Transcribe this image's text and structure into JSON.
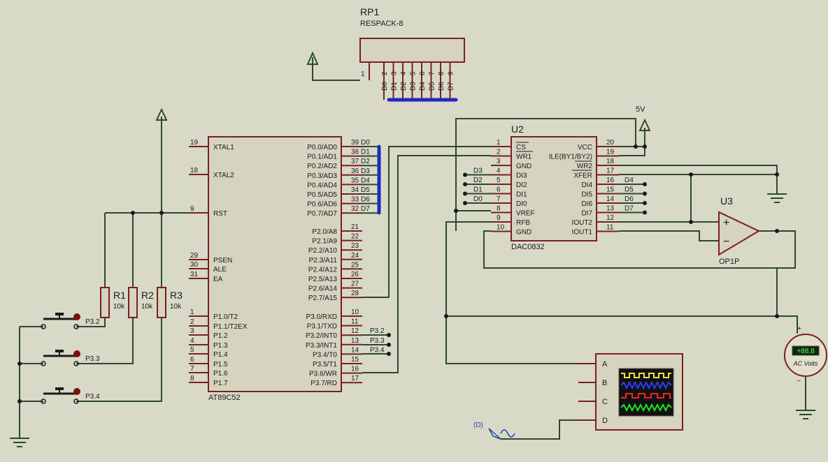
{
  "rp1": {
    "ref": "RP1",
    "value": "RESPACK-8",
    "pin1": "1",
    "pins": [
      "2",
      "3",
      "4",
      "5",
      "6",
      "7",
      "8",
      "9"
    ],
    "labels": [
      "D0",
      "D1",
      "D2",
      "D3",
      "D4",
      "D5",
      "D6",
      "D7"
    ]
  },
  "mcu": {
    "part": "AT89C52",
    "left": [
      {
        "num": "19",
        "name": "XTAL1"
      },
      {
        "num": "18",
        "name": "XTAL2"
      },
      {
        "num": "9",
        "name": "RST"
      },
      {
        "num": "29",
        "name": "PSEN"
      },
      {
        "num": "30",
        "name": "ALE"
      },
      {
        "num": "31",
        "name": "EA"
      },
      {
        "num": "1",
        "name": "P1.0/T2"
      },
      {
        "num": "2",
        "name": "P1.1/T2EX"
      },
      {
        "num": "3",
        "name": "P1.2"
      },
      {
        "num": "4",
        "name": "P1.3"
      },
      {
        "num": "5",
        "name": "P1.4"
      },
      {
        "num": "6",
        "name": "P1.5"
      },
      {
        "num": "7",
        "name": "P1.6"
      },
      {
        "num": "8",
        "name": "P1.7"
      }
    ],
    "right": [
      {
        "num": "39",
        "name": "P0.0/AD0",
        "net": "D0"
      },
      {
        "num": "38",
        "name": "P0.1/AD1",
        "net": "D1"
      },
      {
        "num": "37",
        "name": "P0.2/AD2",
        "net": "D2"
      },
      {
        "num": "36",
        "name": "P0.3/AD3",
        "net": "D3"
      },
      {
        "num": "35",
        "name": "P0.4/AD4",
        "net": "D4"
      },
      {
        "num": "34",
        "name": "P0.5/AD5",
        "net": "D5"
      },
      {
        "num": "33",
        "name": "P0.6/AD6",
        "net": "D6"
      },
      {
        "num": "32",
        "name": "P0.7/AD7",
        "net": "D7"
      },
      {
        "num": "21",
        "name": "P2.0/A8",
        "net": ""
      },
      {
        "num": "22",
        "name": "P2.1/A9",
        "net": ""
      },
      {
        "num": "23",
        "name": "P2.2/A10",
        "net": ""
      },
      {
        "num": "24",
        "name": "P2.3/A11",
        "net": ""
      },
      {
        "num": "25",
        "name": "P2.4/A12",
        "net": ""
      },
      {
        "num": "26",
        "name": "P2.5/A13",
        "net": ""
      },
      {
        "num": "27",
        "name": "P2.6/A14",
        "net": ""
      },
      {
        "num": "28",
        "name": "P2.7/A15",
        "net": ""
      },
      {
        "num": "10",
        "name": "P3.0/RXD",
        "net": ""
      },
      {
        "num": "11",
        "name": "P3.1/TXD",
        "net": ""
      },
      {
        "num": "12",
        "name": "P3.2/INT0",
        "net": "P3.2"
      },
      {
        "num": "13",
        "name": "P3.3/INT1",
        "net": "P3.3"
      },
      {
        "num": "14",
        "name": "P3.4/T0",
        "net": "P3.4"
      },
      {
        "num": "15",
        "name": "P3.5/T1",
        "net": ""
      },
      {
        "num": "16",
        "name": "P3.6/WR",
        "net": ""
      },
      {
        "num": "17",
        "name": "P3.7/RD",
        "net": ""
      }
    ]
  },
  "dac": {
    "ref": "U2",
    "part": "DAC0832",
    "left": [
      {
        "num": "1",
        "name": "CS",
        "net": ""
      },
      {
        "num": "2",
        "name": "WR1",
        "net": ""
      },
      {
        "num": "3",
        "name": "GND",
        "net": ""
      },
      {
        "num": "4",
        "name": "DI3",
        "net": "D3"
      },
      {
        "num": "5",
        "name": "DI2",
        "net": "D2"
      },
      {
        "num": "6",
        "name": "DI1",
        "net": "D1"
      },
      {
        "num": "7",
        "name": "DI0",
        "net": "D0"
      },
      {
        "num": "8",
        "name": "VREF",
        "net": ""
      },
      {
        "num": "9",
        "name": "RFB",
        "net": ""
      },
      {
        "num": "10",
        "name": "GND",
        "net": ""
      }
    ],
    "right": [
      {
        "num": "20",
        "name": "VCC",
        "net": ""
      },
      {
        "num": "19",
        "name": "ILE(BY1/BY2)",
        "net": ""
      },
      {
        "num": "18",
        "name": "WR2",
        "net": ""
      },
      {
        "num": "17",
        "name": "XFER",
        "net": ""
      },
      {
        "num": "16",
        "name": "DI4",
        "net": "D4"
      },
      {
        "num": "15",
        "name": "DI5",
        "net": "D5"
      },
      {
        "num": "14",
        "name": "DI6",
        "net": "D6"
      },
      {
        "num": "13",
        "name": "DI7",
        "net": "D7"
      },
      {
        "num": "12",
        "name": "IOUT2",
        "net": ""
      },
      {
        "num": "11",
        "name": "IOUT1",
        "net": ""
      }
    ]
  },
  "power_label": "5V",
  "opamp": {
    "ref": "U3",
    "part": "OP1P",
    "plus": "+",
    "minus": "−"
  },
  "resistors": [
    {
      "ref": "R1",
      "value": "10k"
    },
    {
      "ref": "R2",
      "value": "10k"
    },
    {
      "ref": "R3",
      "value": "10k"
    }
  ],
  "buttons": [
    "P3.2",
    "P3.3",
    "P3.4"
  ],
  "scope": {
    "channels": [
      "A",
      "B",
      "C",
      "D"
    ]
  },
  "voltmeter": {
    "reading": "+88.8",
    "unit": "AC Volts",
    "plus": "+",
    "minus": "−"
  },
  "generator_label": "(D)",
  "colors": {
    "background": "#d9d9c8",
    "wire": "#2b4a2b",
    "component": "#7a1f1f",
    "bus": "#1b28c8"
  }
}
